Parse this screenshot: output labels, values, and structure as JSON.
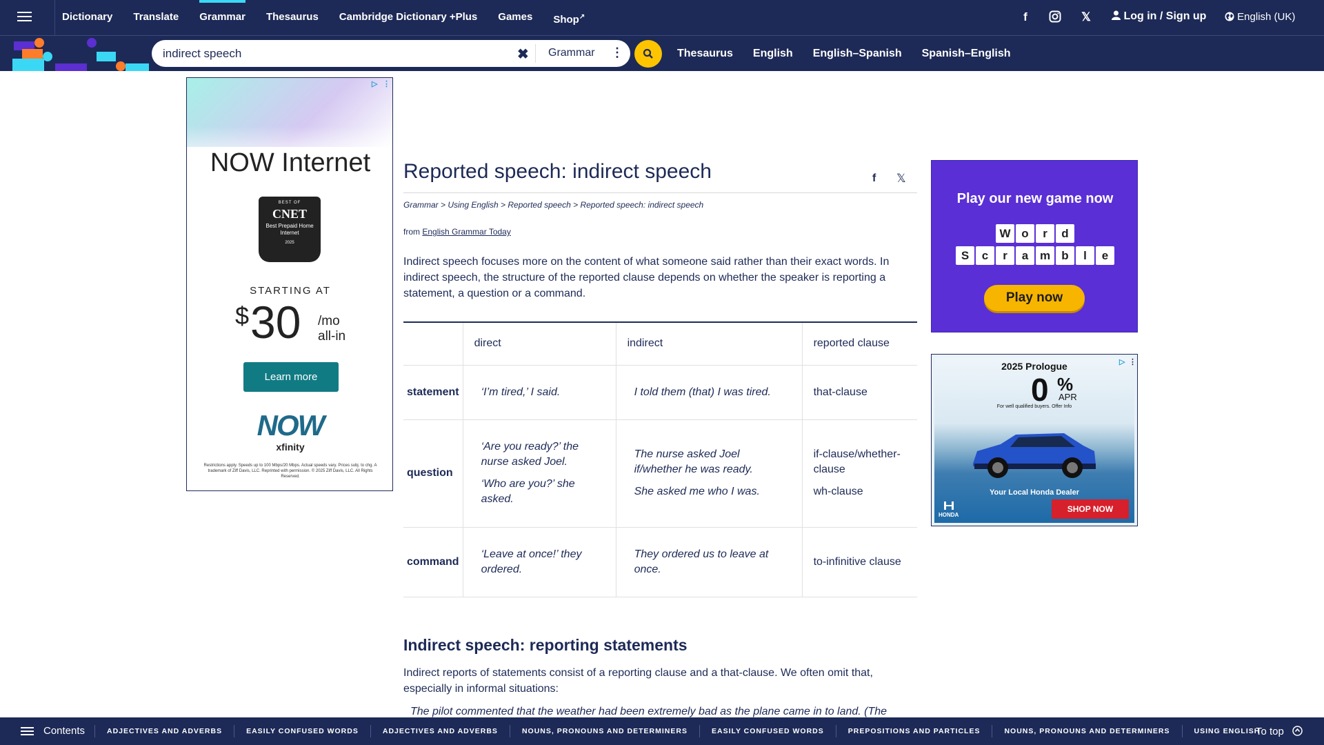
{
  "topnav": {
    "items": [
      "Dictionary",
      "Translate",
      "Grammar",
      "Thesaurus",
      "Cambridge Dictionary +Plus",
      "Games",
      "Shop"
    ],
    "active": "Grammar",
    "login": "Log in",
    "login_sep": "/",
    "signup": "Sign up",
    "language": "English (UK)"
  },
  "search": {
    "value": "indirect speech",
    "dictionary": "Grammar",
    "links": [
      "Thesaurus",
      "English",
      "English–Spanish",
      "Spanish–English"
    ]
  },
  "ad_left": {
    "headline": "NOW Internet",
    "badge_top": "BEST OF",
    "badge_brand": "CNET",
    "badge_text": "Best Prepaid Home Internet",
    "badge_year": "2025",
    "starting": "STARTING AT",
    "currency": "$",
    "price": "30",
    "per": "/mo",
    "allin": "all-in",
    "cta": "Learn more",
    "logo": "NOW",
    "logo_sub": "xfinity",
    "fine": "Restrictions apply. Speeds up to 100 Mbps/20 Mbps. Actual speeds vary. Prices subj. to chg. A trademark of Ziff Davis, LLC. Reprinted with permission. © 2025 Ziff Davis, LLC. All Rights Reserved."
  },
  "article": {
    "title": "Reported speech: indirect speech",
    "breadcrumb": "Grammar > Using English > Reported speech > Reported speech: indirect speech",
    "from_label": "from",
    "from_link": "English Grammar Today",
    "intro": "Indirect speech focuses more on the content of what someone said rather than their exact words. In indirect speech, the structure of the reported clause depends on whether the speaker is reporting a statement, a question or a command.",
    "table": {
      "headers": [
        "direct",
        "indirect",
        "reported clause"
      ],
      "rows": [
        {
          "label": "statement",
          "direct": [
            "‘I’m tired,’ I said."
          ],
          "indirect": [
            "I told them (that) I was tired."
          ],
          "reported": [
            "that-clause"
          ]
        },
        {
          "label": "question",
          "direct": [
            "‘Are you ready?’ the nurse asked Joel.",
            "‘Who are you?’ she asked."
          ],
          "indirect": [
            "The nurse asked Joel if/whether he was ready.",
            "She asked me who I was."
          ],
          "reported": [
            "if-clause/whether-clause",
            "wh-clause"
          ]
        },
        {
          "label": "command",
          "direct": [
            "‘Leave at once!’ they ordered."
          ],
          "indirect": [
            "They ordered us to leave at once."
          ],
          "reported": [
            "to-infinitive clause"
          ]
        }
      ]
    },
    "section_heading": "Indirect speech: reporting statements",
    "section_text": "Indirect reports of statements consist of a reporting clause and a that-clause. We often omit that, especially in informal situations:",
    "example": "The pilot commented that the weather had been extremely bad as the plane came in to land. (The"
  },
  "ad_game": {
    "headline": "Play our new game now",
    "word1": [
      "W",
      "o",
      "r",
      "d"
    ],
    "word2": [
      "S",
      "c",
      "r",
      "a",
      "m",
      "b",
      "l",
      "e"
    ],
    "cta": "Play now"
  },
  "ad_honda": {
    "title": "2025 Prologue",
    "rate": "0",
    "pct": "%",
    "apr": "APR",
    "fine": "For well qualified buyers. Offer Info",
    "dealer": "Your Local Honda Dealer",
    "brand": "HONDA",
    "cta": "SHOP NOW"
  },
  "bottombar": {
    "contents": "Contents",
    "categories": [
      "ADJECTIVES AND ADVERBS",
      "EASILY CONFUSED WORDS",
      "ADJECTIVES AND ADVERBS",
      "NOUNS, PRONOUNS AND DETERMINERS",
      "EASILY CONFUSED WORDS",
      "PREPOSITIONS AND PARTICLES",
      "NOUNS, PRONOUNS AND DETERMINERS",
      "USING ENGLISH"
    ],
    "to_top": "To top"
  },
  "colors": {
    "navy": "#1d2a57",
    "accent_cyan": "#3bd8f5",
    "search_yellow": "#fec400",
    "game_purple": "#5a2fd6"
  }
}
